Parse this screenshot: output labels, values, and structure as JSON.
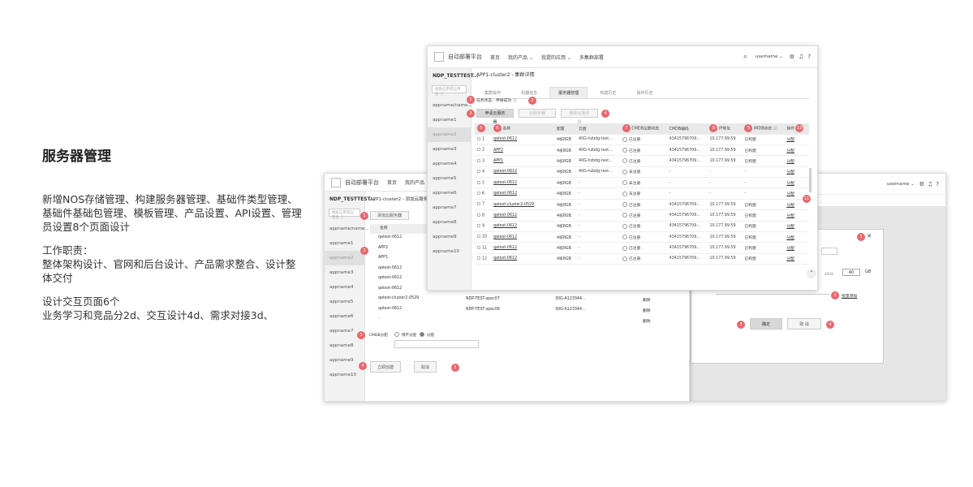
{
  "intro": {
    "heading": "服务器管理",
    "p1": "新增NOS存储管理、构建服务器管理、基础件类型管理、基础件基础包管理、模板管理、产品设置、API设置、管理员设置8个页面设计",
    "p2a": "工作职责：",
    "p2b": "整体架构设计、官网和后台设计、产品需求整合、设计整体交付",
    "p3a": "设计交互页面6个",
    "p3b": "业务学习和竞品分2d、交互设计4d、需求对接3d、"
  },
  "app": {
    "platform": "自动部署平台",
    "nav": [
      "首页",
      "我的产品 ⌄",
      "我提的应用 ⌄",
      "多集群部署"
    ],
    "username": "username ⌄",
    "search_placeholder": "搜索应用或应用名 ⓘ",
    "sidebar_title": "NDP_TESTTEST...",
    "sidebar_title2": "NDP_TESTTEST...",
    "apps": [
      "appname/name...",
      "appname1",
      "appname2",
      "appname3",
      "appname4",
      "appname5",
      "appname6",
      "appname7",
      "appname8",
      "appname9",
      "appname10"
    ]
  },
  "main": {
    "breadcrumb": "APP1-cluster2 - 集群详情",
    "tabs": [
      "集群操作",
      "机器信息",
      "服务器管理",
      "构建历史",
      "操作历史"
    ],
    "status": "任务状态：申请成功 ⓘ",
    "btn_apply": "申请云服务器",
    "btn_add": "云服务器",
    "btn_delete": "删除云服务器",
    "columns": [
      "名称",
      "配置",
      "云盘",
      "CMDB注册状态",
      "CMDB编码",
      "IP地址",
      "IMDB状态 ⓘ",
      "操作"
    ],
    "rows": [
      {
        "idx": "1",
        "name": "qatest-0612",
        "cfg": "4核8GB",
        "disk": "40G-hzbdg-test...",
        "reg": "已注册",
        "code": "43415796709...",
        "ip": "10.177.99.59",
        "imdb": "已构建",
        "op": "分配"
      },
      {
        "idx": "2",
        "name": "APP2",
        "cfg": "4核8GB",
        "disk": "40G-hzbdg-test...",
        "reg": "已注册",
        "code": "43415796709...",
        "ip": "10.177.99.59",
        "imdb": "已构建",
        "op": "分配"
      },
      {
        "idx": "3",
        "name": "APP1",
        "cfg": "4核8GB",
        "disk": "40G-hzbdg-test...",
        "reg": "已注册",
        "code": "43415796709...",
        "ip": "10.177.99.59",
        "imdb": "已构建",
        "op": "分配"
      },
      {
        "idx": "4",
        "name": "qatest-0612",
        "cfg": "4核8GB",
        "disk": "40G-hzbdg-test...",
        "reg": "未注册",
        "code": "-",
        "ip": "-",
        "imdb": "-",
        "op": "分配"
      },
      {
        "idx": "5",
        "name": "qatest-0612",
        "cfg": "4核8GB",
        "disk": "-",
        "reg": "未注册",
        "code": "-",
        "ip": "-",
        "imdb": "-",
        "op": "分配"
      },
      {
        "idx": "6",
        "name": "qatest-0612",
        "cfg": "4核8GB",
        "disk": "-",
        "reg": "未注册",
        "code": "-",
        "ip": "-",
        "imdb": "-",
        "op": "分配"
      },
      {
        "idx": "7",
        "name": "qatest-cluster2-0529",
        "cfg": "4核8GB",
        "disk": "-",
        "reg": "已注册",
        "code": "43415796709...",
        "ip": "10.177.99.59",
        "imdb": "已构建",
        "op": "分配"
      },
      {
        "idx": "8",
        "name": "qatest-0612",
        "cfg": "4核8GB",
        "disk": "-",
        "reg": "已注册",
        "code": "43415796709...",
        "ip": "10.177.99.59",
        "imdb": "已构建",
        "op": "分配"
      },
      {
        "idx": "9",
        "name": "qatest-0612",
        "cfg": "4核8GB",
        "disk": "-",
        "reg": "已注册",
        "code": "43415796709...",
        "ip": "10.177.99.59",
        "imdb": "已构建",
        "op": "分配"
      },
      {
        "idx": "10",
        "name": "qatest-0612",
        "cfg": "4核8GB",
        "disk": "-",
        "reg": "已注册",
        "code": "43415796709...",
        "ip": "10.177.99.59",
        "imdb": "已构建",
        "op": "分配"
      },
      {
        "idx": "11",
        "name": "qatest-0612",
        "cfg": "4核8GB",
        "disk": "-",
        "reg": "已注册",
        "code": "43415796709...",
        "ip": "10.177.99.59",
        "imdb": "已构建",
        "op": "分配"
      },
      {
        "idx": "12",
        "name": "qatest-0612",
        "cfg": "4核8GB",
        "disk": "-",
        "reg": "已注册",
        "code": "43415796709...",
        "ip": "10.177.99.59",
        "imdb": "已构建",
        "op": "分配"
      }
    ],
    "badges": [
      "1",
      "2",
      "3",
      "4",
      "5",
      "6",
      "7",
      "8",
      "9",
      "10",
      "11"
    ]
  },
  "second": {
    "breadcrumb": "APP1-cluster2 - 添加云服务器",
    "btn_add": "添加云服务器",
    "col_name": "名称",
    "list": [
      "qatest-0612",
      "APP2",
      "APP1",
      "qatest-0612",
      "qatest-0612",
      "qatest-0612",
      "qatest-cluster2-0529",
      "qatest-0612",
      "-"
    ],
    "specs": [
      "NDP-TEST-spec07",
      "NDP-TEST-spec08"
    ],
    "disks": [
      "30G-A123344...",
      "30G-A123344..."
    ],
    "action": "删除",
    "cmdb_label": "CMDB分配",
    "radio1": "稍不分配",
    "radio2": "分配",
    "btn_create": "立即创建",
    "btn_cancel": "取消",
    "badges": [
      "1",
      "2",
      "3",
      "4",
      "5",
      "6"
    ]
  },
  "third": {
    "disk_value": "40",
    "disk_unit": "GB",
    "mini_label": "40GB",
    "add_disk": "批量添加",
    "btn_ok": "确定",
    "btn_cancel": "取 消",
    "close": "✕",
    "badges": [
      "1",
      "2",
      "3",
      "4"
    ]
  }
}
